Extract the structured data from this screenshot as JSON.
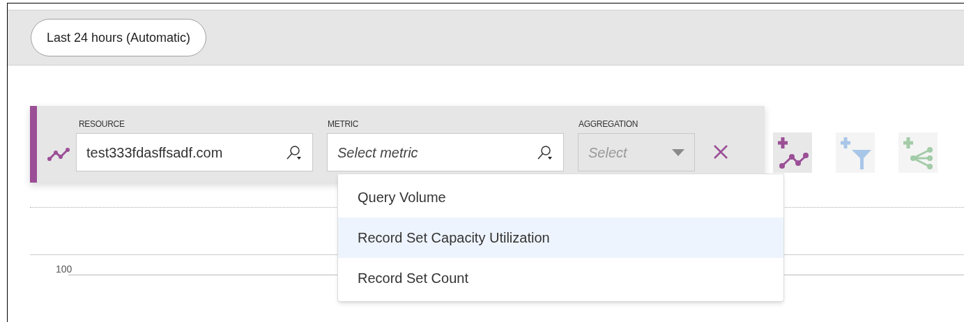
{
  "time_range": {
    "label": "Last 24 hours (Automatic)"
  },
  "metric_row": {
    "resource": {
      "label": "RESOURCE",
      "value": "test333fdasffsadf.com"
    },
    "metric": {
      "label": "METRIC",
      "placeholder": "Select metric",
      "expanded": true
    },
    "aggregation": {
      "label": "AGGREGATION",
      "placeholder": "Select",
      "disabled": true
    }
  },
  "metric_options": [
    {
      "label": "Query Volume",
      "selected": false
    },
    {
      "label": "Record Set Capacity Utilization",
      "selected": true
    },
    {
      "label": "Record Set Count",
      "selected": false
    }
  ],
  "chart": {
    "y_tick": "100"
  }
}
